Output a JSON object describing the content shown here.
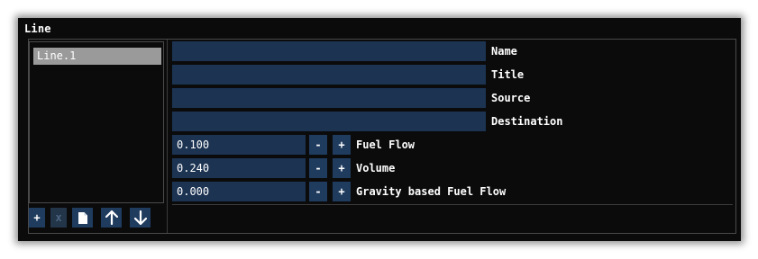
{
  "panel": {
    "title": "Line"
  },
  "list": {
    "items": [
      {
        "label": "Line.1",
        "selected": true
      }
    ]
  },
  "toolbar": {
    "add_label": "+",
    "remove_label": "x",
    "buttons": [
      {
        "name": "add",
        "icon": "plus"
      },
      {
        "name": "remove",
        "icon": "x",
        "disabled": true
      },
      {
        "name": "duplicate",
        "icon": "document-icon"
      },
      {
        "name": "move-up",
        "icon": "arrow-up-icon"
      },
      {
        "name": "move-down",
        "icon": "arrow-down-icon"
      }
    ]
  },
  "fields": {
    "name": {
      "label": "Name",
      "value": ""
    },
    "title": {
      "label": "Title",
      "value": ""
    },
    "source": {
      "label": "Source",
      "value": ""
    },
    "destination": {
      "label": "Destination",
      "value": ""
    },
    "fuel_flow": {
      "label": "Fuel Flow",
      "value": "0.100"
    },
    "volume": {
      "label": "Volume",
      "value": "0.240"
    },
    "gravity_fuel_flow": {
      "label": "Gravity based Fuel Flow",
      "value": "0.000"
    }
  },
  "stepper": {
    "minus": "-",
    "plus": "+"
  },
  "colors": {
    "panel_bg": "#0b0b0b",
    "field_bg": "#1c3352",
    "button_bg": "#1f3b5e",
    "selected_item_bg": "#9a9a9a",
    "text": "#ffffff"
  }
}
